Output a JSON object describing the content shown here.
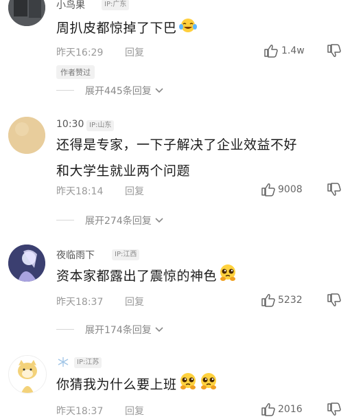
{
  "comments": [
    {
      "username": "小鸟果",
      "ip": "IP:广东",
      "text": "周扒皮都惊掉了下巴",
      "time": "昨天16:29",
      "reply": "回复",
      "likes": "1.4w",
      "badge": "作者赞过",
      "expand": "展开445条回复"
    },
    {
      "username": "10:30",
      "ip": "IP:山东",
      "text_line1": "还得是专家，一下子解决了企业效益不好",
      "text_line2": "和大学生就业两个问题",
      "time": "昨天18:14",
      "reply": "回复",
      "likes": "9008",
      "expand": "展开274条回复"
    },
    {
      "username": "夜临雨下",
      "ip": "IP:江西",
      "text": "资本家都露出了震惊的神色",
      "time": "昨天18:37",
      "reply": "回复",
      "likes": "5232",
      "expand": "展开174条回复"
    },
    {
      "username": "",
      "ip": "IP:江苏",
      "text": "你猜我为什么要上班",
      "time": "昨天18:37",
      "reply": "回复",
      "likes": "2016"
    }
  ],
  "colors": {
    "text": "#1a1a1a",
    "muted": "#999999",
    "tag_bg": "#f1f1f1"
  },
  "icons": [
    "like-icon",
    "dislike-icon",
    "chevron-down-icon",
    "crying-laughing-emoji",
    "pleading-face-emoji"
  ]
}
